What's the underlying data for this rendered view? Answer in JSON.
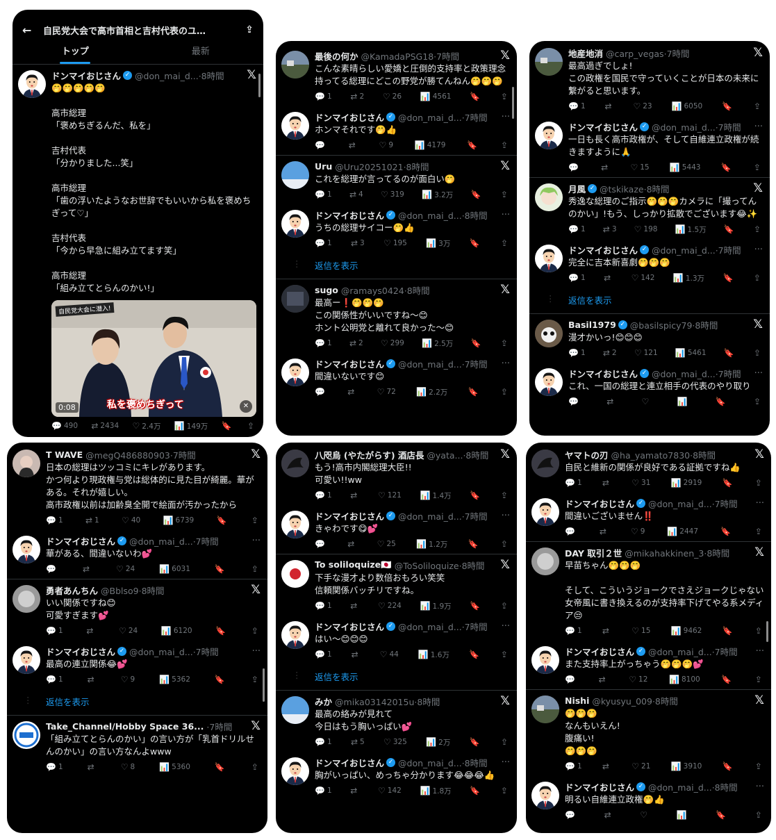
{
  "top_bar": {
    "title": "自民党大会で高市首相と吉村代表のユ…",
    "back_icon": "arrow-left-icon",
    "share_icon": "share-icon",
    "tab_top": "トップ",
    "tab_latest": "最新"
  },
  "video": {
    "time": "0:08",
    "caption": "私を褒めちぎって",
    "badge": "自民党大会に潜入!"
  },
  "show_replies": "返信を表示",
  "colors": {
    "background": "#000000",
    "accent": "#1d9bf0",
    "text": "#e7e9ea",
    "muted": "#71767b"
  },
  "panels": [
    {
      "tweets": [
        {
          "name": "ドンマイおじさん",
          "verified": true,
          "handle": "@don_mai_d...",
          "time": "8時間",
          "end": "x",
          "avatar": "man",
          "text": "🤭🤭🤭🤭🤭\n\n高市総理\n「褒めちぎるんだ、私を」\n\n吉村代表\n「分かりました...笑」\n\n高市総理\n「歯の浮いたようなお世辞でもいいから私を褒めちぎって♡」\n\n吉村代表\n「今から早急に組み立てます笑」\n\n高市総理\n「組み立てとらんのかい!」",
          "has_video": true,
          "replies": "490",
          "retweets": "2434",
          "likes": "2.4万",
          "views": "149万"
        }
      ]
    },
    {
      "tweets": [
        {
          "name": "最後の何か",
          "verified": false,
          "handle": "@KamadaPSG18",
          "time": "7時間",
          "end": "x",
          "avatar": "landscape",
          "text": "こんな素晴らしい愛嬌と圧倒的支持率と政策理念持ってる総理にどこの野党が勝てんねん🤭🤭🤭",
          "replies": "1",
          "retweets": "2",
          "likes": "26",
          "views": "4561"
        },
        {
          "name": "ドンマイおじさん",
          "verified": true,
          "handle": "@don_mai_d...",
          "time": "7時間",
          "end": "dots",
          "avatar": "man",
          "text": "ホンマそれです🤭👍",
          "replies": "",
          "retweets": "",
          "likes": "9",
          "views": "4179"
        },
        {
          "name": "Uru",
          "verified": false,
          "handle": "@Uru20251021",
          "time": "8時間",
          "end": "x",
          "avatar": "sky",
          "text": "これを総理が言ってるのが面白い🤭",
          "replies": "1",
          "retweets": "4",
          "likes": "319",
          "views": "3.2万"
        },
        {
          "name": "ドンマイおじさん",
          "verified": true,
          "handle": "@don_mai_d...",
          "time": "8時間",
          "end": "dots",
          "avatar": "man",
          "text": "うちの総理サイコー🤭👍",
          "replies": "1",
          "retweets": "3",
          "likes": "195",
          "views": "3万",
          "show_replies": true
        },
        {
          "name": "sugo",
          "verified": false,
          "handle": "@ramays0424",
          "time": "8時間",
          "end": "x",
          "avatar": "dark",
          "text": "最高ー❗🤭🤭🤭\nこの関係性がいいですね〜😊\nホント公明党と離れて良かった〜😊",
          "replies": "1",
          "retweets": "2",
          "likes": "299",
          "views": "2.5万"
        },
        {
          "name": "ドンマイおじさん",
          "verified": true,
          "handle": "@don_mai_d...",
          "time": "7時間",
          "end": "dots",
          "avatar": "man",
          "text": "間違いないです😊",
          "replies": "",
          "retweets": "",
          "likes": "72",
          "views": "2.2万"
        }
      ]
    },
    {
      "tweets": [
        {
          "name": "地産地消",
          "verified": false,
          "handle": "@carp_vegas",
          "time": "7時間",
          "end": "x",
          "avatar": "landscape",
          "text": "最高過ぎでしょ!\nこの政権を国民で守っていくことが日本の未来に\n繋がると思います。",
          "replies": "1",
          "retweets": "",
          "likes": "23",
          "views": "6050"
        },
        {
          "name": "ドンマイおじさん",
          "verified": true,
          "handle": "@don_mai_d...",
          "time": "7時間",
          "end": "dots",
          "avatar": "man",
          "text": "一日も長く高市政権が、そして自維連立政権が続きますように🙏",
          "replies": "",
          "retweets": "",
          "likes": "15",
          "views": "5443"
        },
        {
          "name": "月風",
          "verified": true,
          "handle": "@tskikaze",
          "time": "8時間",
          "end": "x",
          "avatar": "anime",
          "text": "秀逸な総理のご指示🤭🤭🤭カメラに「撮ってんのかい」!もう、しっかり拡散でございます😂✨",
          "replies": "1",
          "retweets": "3",
          "likes": "198",
          "views": "1.5万"
        },
        {
          "name": "ドンマイおじさん",
          "verified": true,
          "handle": "@don_mai_d...",
          "time": "7時間",
          "end": "dots",
          "avatar": "man",
          "text": "完全に吉本新喜劇🤭🤭🤭",
          "replies": "1",
          "retweets": "",
          "likes": "142",
          "views": "1.3万",
          "show_replies": true
        },
        {
          "name": "Basil1979",
          "verified": true,
          "handle": "@basilspicy79",
          "time": "8時間",
          "end": "x",
          "avatar": "panda",
          "text": "漫才かいっ!😊😊😊",
          "replies": "1",
          "retweets": "2",
          "likes": "121",
          "views": "5461"
        },
        {
          "name": "ドンマイおじさん",
          "verified": true,
          "handle": "@don_mai_d...",
          "time": "7時間",
          "end": "dots",
          "avatar": "man",
          "text": "これ、一国の総理と連立相手の代表のやり取り",
          "replies": "",
          "retweets": "",
          "likes": "",
          "views": ""
        }
      ]
    },
    {
      "tweets": [
        {
          "name": "T WAVE",
          "verified": false,
          "handle": "@megQ486880903",
          "time": "7時間",
          "end": "x",
          "avatar": "woman",
          "text": "日本の総理はツッコミにキレがあります。\nかつ何より現政権与党は総体的に見た目が綺麗。華がある。それが嬉しい。\n高市政権以前は加齢臭全開で絵面が汚かったから",
          "replies": "1",
          "retweets": "1",
          "likes": "40",
          "views": "6739"
        },
        {
          "name": "ドンマイおじさん",
          "verified": true,
          "handle": "@don_mai_d...",
          "time": "7時間",
          "end": "dots",
          "avatar": "man",
          "text": "華がある、間違いないわ💕",
          "replies": "",
          "retweets": "",
          "likes": "24",
          "views": "6031"
        },
        {
          "name": "勇者あんちん",
          "verified": false,
          "handle": "@Bblso9",
          "time": "8時間",
          "end": "x",
          "avatar": "blur",
          "text": "いい関係ですね😊\n可愛すぎます💕",
          "replies": "1",
          "retweets": "",
          "likes": "24",
          "views": "6120"
        },
        {
          "name": "ドンマイおじさん",
          "verified": true,
          "handle": "@don_mai_d...",
          "time": "7時間",
          "end": "dots",
          "avatar": "man",
          "text": "最高の連立関係😂💕",
          "replies": "1",
          "retweets": "",
          "likes": "9",
          "views": "5362",
          "show_replies": true
        },
        {
          "name": "Take_Channel/Hobby Space 36...",
          "verified": false,
          "handle": "",
          "time": "7時間",
          "end": "x",
          "avatar": "logo",
          "text": "「組み立てとらんのかい」の言い方が「乳首ドリルせんのかい」の言い方なんよwww",
          "replies": "1",
          "retweets": "",
          "likes": "8",
          "views": "5360"
        }
      ]
    },
    {
      "tweets": [
        {
          "name": "八咫烏 (やたがらす) 酒店長",
          "verified": false,
          "handle": "@yata...",
          "time": "8時間",
          "end": "x",
          "avatar": "crow",
          "text": "もう!高市内閣総理大臣!!\n可愛い!!ww",
          "replies": "1",
          "retweets": "",
          "likes": "121",
          "views": "1.4万"
        },
        {
          "name": "ドンマイおじさん",
          "verified": true,
          "handle": "@don_mai_d...",
          "time": "7時間",
          "end": "dots",
          "avatar": "man",
          "text": "きゃわです😋💕",
          "replies": "",
          "retweets": "",
          "likes": "25",
          "views": "1.2万"
        },
        {
          "name": "To soliloquize🇯🇵",
          "verified": false,
          "handle": "@ToSoliloquize",
          "time": "8時間",
          "end": "x",
          "avatar": "flag",
          "text": "下手な漫才より数倍おもろい笑笑\n信頼関係バッチリですね。",
          "replies": "1",
          "retweets": "",
          "likes": "224",
          "views": "1.9万"
        },
        {
          "name": "ドンマイおじさん",
          "verified": true,
          "handle": "@don_mai_d...",
          "time": "7時間",
          "end": "dots",
          "avatar": "man",
          "text": "はい〜😊😊😊",
          "replies": "1",
          "retweets": "",
          "likes": "44",
          "views": "1.6万",
          "show_replies": true
        },
        {
          "name": "みか",
          "verified": false,
          "handle": "@mika03142015u",
          "time": "8時間",
          "end": "x",
          "avatar": "sky",
          "text": "最高の絡みが見れて\n今日はもう胸いっぱい💕",
          "replies": "1",
          "retweets": "5",
          "likes": "325",
          "views": "2万"
        },
        {
          "name": "ドンマイおじさん",
          "verified": true,
          "handle": "@don_mai_d...",
          "time": "8時間",
          "end": "dots",
          "avatar": "man",
          "text": "胸がいっぱい、めっちゃ分かります😂😂😂👍",
          "replies": "1",
          "retweets": "",
          "likes": "142",
          "views": "1.8万"
        }
      ]
    },
    {
      "tweets": [
        {
          "name": "ヤマトの刃",
          "verified": false,
          "handle": "@ha_yamato7830",
          "time": "8時間",
          "end": "x",
          "avatar": "crow",
          "text": "自民と維新の関係が良好である証拠ですね👍",
          "replies": "1",
          "retweets": "",
          "likes": "31",
          "views": "2919"
        },
        {
          "name": "ドンマイおじさん",
          "verified": true,
          "handle": "@don_mai_d...",
          "time": "7時間",
          "end": "dots",
          "avatar": "man",
          "text": "間違いございません‼️",
          "replies": "",
          "retweets": "",
          "likes": "9",
          "views": "2447"
        },
        {
          "name": "DAY 取引２世",
          "verified": false,
          "handle": "@mikahakkinen_3",
          "time": "8時間",
          "end": "x",
          "avatar": "blur",
          "text": "早苗ちゃん🤭🤭🤭\n\nそして、こういうジョークでさえジョークじゃない女帝風に書き換えるのが支持率下げてやる系メディア😒",
          "replies": "1",
          "retweets": "",
          "likes": "15",
          "views": "9462"
        },
        {
          "name": "ドンマイおじさん",
          "verified": true,
          "handle": "@don_mai_d...",
          "time": "7時間",
          "end": "dots",
          "avatar": "man",
          "text": "また支持率上がっちゃう🤭🤭🤭💕",
          "replies": "",
          "retweets": "",
          "likes": "12",
          "views": "8100"
        },
        {
          "name": "Nishi",
          "verified": false,
          "handle": "@kyusyu_009",
          "time": "8時間",
          "end": "x",
          "avatar": "landscape",
          "text": "🤭🤭🤭\nなんもいえん!\n腹痛い!\n🤭🤭🤭",
          "replies": "1",
          "retweets": "",
          "likes": "21",
          "views": "3910"
        },
        {
          "name": "ドンマイおじさん",
          "verified": true,
          "handle": "@don_mai_d...",
          "time": "8時間",
          "end": "dots",
          "avatar": "man",
          "text": "明るい自維連立政権🤭👍",
          "replies": "",
          "retweets": "",
          "likes": "",
          "views": ""
        }
      ]
    }
  ]
}
